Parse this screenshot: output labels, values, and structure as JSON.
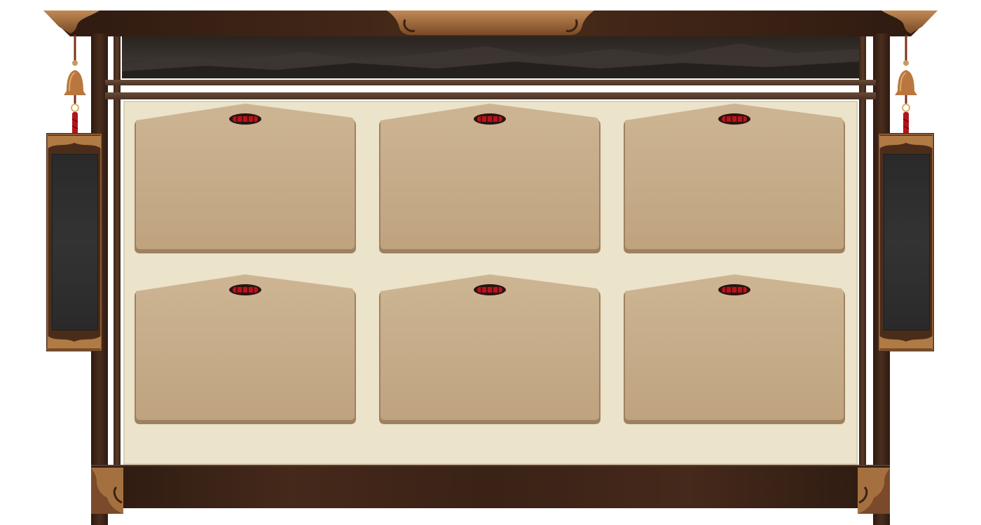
{
  "board": {
    "plaques": [
      {
        "message": ""
      },
      {
        "message": ""
      },
      {
        "message": ""
      },
      {
        "message": ""
      },
      {
        "message": ""
      },
      {
        "message": ""
      }
    ]
  },
  "banners": {
    "left": {
      "text": ""
    },
    "right": {
      "text": ""
    }
  },
  "colors": {
    "wood_dark": "#2e1a10",
    "wood_mid": "#5a3a28",
    "bronze": "#8a5a34",
    "board_bg": "#ebe3ca",
    "plaque_wood": "#c6ad8b",
    "banner_screen": "#2d2d2d",
    "tassel_red": "#b4141c"
  },
  "icons": {
    "plaque_knot": "rope-knot-icon",
    "bell": "bronze-bell-icon",
    "roof_ornament": "scroll-ornament-icon"
  }
}
